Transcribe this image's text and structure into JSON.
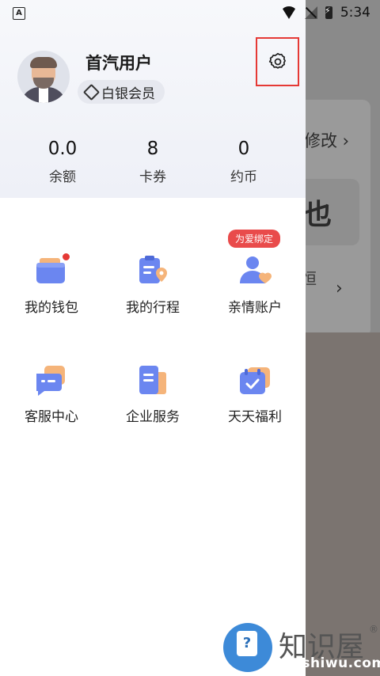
{
  "status_bar": {
    "time": "5:34",
    "app_letter": "A"
  },
  "background": {
    "modify_text": "修改 ›",
    "big_char": "也",
    "side_char": "恒",
    "chevron": "›"
  },
  "profile": {
    "username": "首汽用户",
    "member_level": "白银会员"
  },
  "stats": [
    {
      "value": "0.0",
      "label": "余额"
    },
    {
      "value": "8",
      "label": "卡券"
    },
    {
      "value": "0",
      "label": "约币"
    }
  ],
  "menu": {
    "row1": [
      {
        "label": "我的钱包",
        "icon": "wallet-icon"
      },
      {
        "label": "我的行程",
        "icon": "trip-icon"
      },
      {
        "label": "亲情账户",
        "icon": "family-account-icon",
        "tag": "为爱绑定"
      }
    ],
    "row2": [
      {
        "label": "客服中心",
        "icon": "customer-service-icon"
      },
      {
        "label": "企业服务",
        "icon": "enterprise-icon"
      },
      {
        "label": "天天福利",
        "icon": "daily-welfare-icon"
      }
    ]
  },
  "watermark": {
    "title": "知识屋",
    "url": "zhishiwu.com",
    "registered": "®",
    "icon_glyph": "?"
  },
  "colors": {
    "accent_red": "#e53935",
    "icon_blue": "#6b86f0",
    "icon_orange": "#f5b47a"
  }
}
